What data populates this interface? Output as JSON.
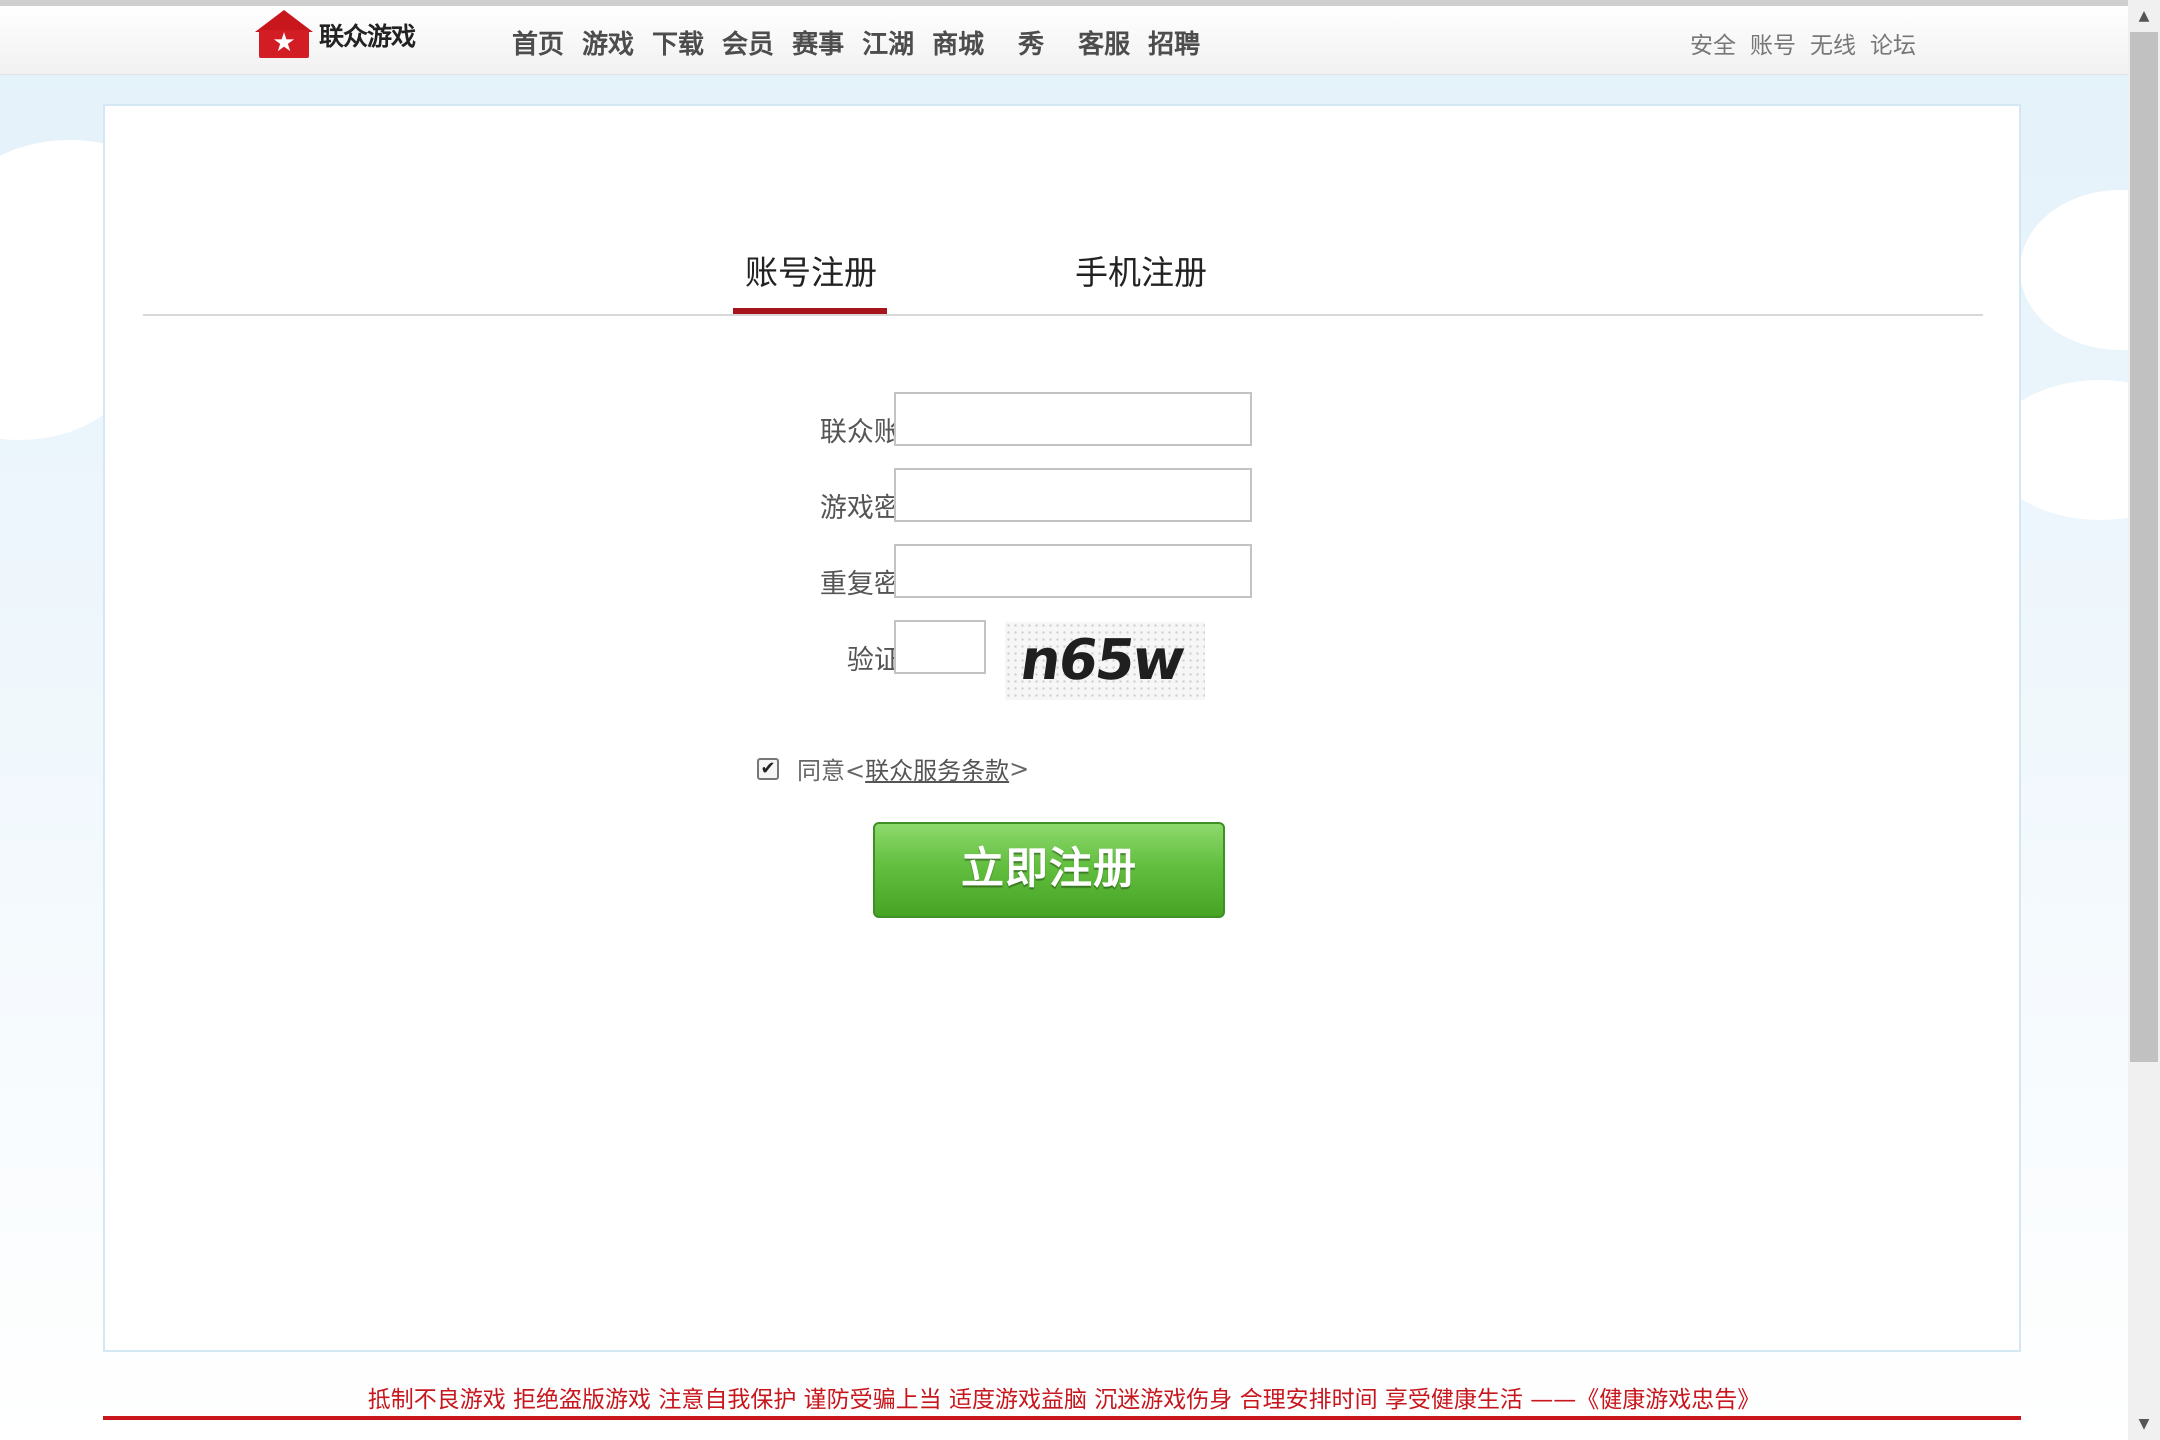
{
  "header": {
    "logo_text": "联众游戏",
    "logo_star": "★",
    "main_nav": [
      {
        "label": "首页"
      },
      {
        "label": "游戏"
      },
      {
        "label": "下载"
      },
      {
        "label": "会员"
      },
      {
        "label": "赛事"
      },
      {
        "label": "江湖"
      },
      {
        "label": "商城"
      },
      {
        "label": "秀"
      },
      {
        "label": "客服"
      },
      {
        "label": "招聘"
      }
    ],
    "side_nav": [
      {
        "label": "安全"
      },
      {
        "label": "账号"
      },
      {
        "label": "无线"
      },
      {
        "label": "论坛"
      }
    ]
  },
  "tabs": [
    {
      "label": "账号注册",
      "active": true
    },
    {
      "label": "手机注册",
      "active": false
    }
  ],
  "form": {
    "account_label": "联众账号:",
    "account_value": "",
    "password_label": "游戏密码:",
    "password_value": "",
    "repeat_label": "重复密码:",
    "repeat_value": "",
    "captcha_label": "验证码:",
    "captcha_value": "",
    "captcha_image_text": "n65w",
    "agree_checked": true,
    "agree_prefix": "同意<",
    "agree_link": "联众服务条款",
    "agree_suffix": ">",
    "submit_label": "立即注册"
  },
  "footer": {
    "notice": "抵制不良游戏 拒绝盗版游戏 注意自我保护 谨防受骗上当 适度游戏益脑 沉迷游戏伤身 合理安排时间 享受健康生活 ——《健康游戏忠告》"
  },
  "colors": {
    "brand_red": "#c8161d",
    "button_green": "#62bf3f",
    "tab_active_underline": "#a5151b"
  }
}
